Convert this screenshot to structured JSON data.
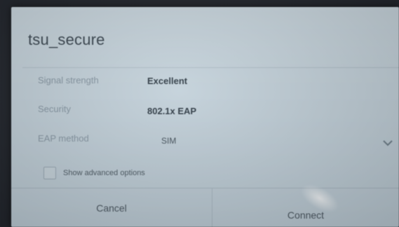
{
  "dialog": {
    "title": "tsu_secure",
    "fields": {
      "signal_label": "Signal strength",
      "signal_value": "Excellent",
      "security_label": "Security",
      "security_value": "802.1x EAP",
      "eap_label": "EAP method",
      "eap_value": "SIM"
    },
    "advanced_label": "Show advanced options",
    "advanced_checked": false,
    "buttons": {
      "cancel": "Cancel",
      "connect": "Connect"
    }
  },
  "icons": {
    "dropdown": "chevron-down-icon",
    "checkbox": "checkbox-icon"
  },
  "colors": {
    "dialog_background": "#c6d3db",
    "background": "#22262d"
  }
}
